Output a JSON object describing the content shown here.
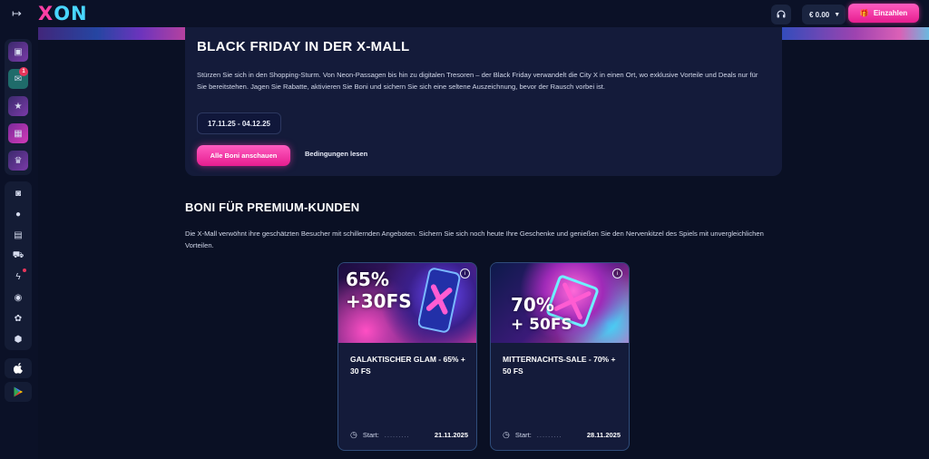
{
  "header": {
    "logo_x": "X",
    "logo_on": "ON",
    "balance": "€ 0.00",
    "deposit_label": "Einzahlen"
  },
  "sidebar": {
    "messages_badge": "1",
    "icons": [
      "games-icon",
      "mail-icon",
      "promo-icon",
      "gift-icon",
      "trophy-icon",
      "casino-icon",
      "sports-icon",
      "bonus-icon",
      "shop-icon",
      "flash-icon",
      "profile-icon",
      "settings-icon",
      "shield-icon",
      "apple-icon",
      "google-play-icon"
    ]
  },
  "promo": {
    "title": "BLACK FRIDAY IN DER X-MALL",
    "text": "Stürzen Sie sich in den Shopping-Sturm. Von Neon-Passagen bis hin zu digitalen Tresoren – der Black Friday verwandelt die City X in einen Ort, wo exklusive Vorteile und Deals nur für Sie bereitstehen. Jagen Sie Rabatte, aktivieren Sie Boni und sichern Sie sich eine seltene Auszeichnung, bevor der Rausch vorbei ist.",
    "date_range": "17.11.25 - 04.12.25",
    "cta_label": "Alle Boni anschauen",
    "terms_label": "Bedingungen lesen"
  },
  "premium": {
    "title": "BONI FÜR PREMIUM-KUNDEN",
    "text": "Die X-Mall verwöhnt ihre geschätzten Besucher mit schillernden Angeboten. Sichern Sie sich noch heute Ihre Geschenke und genießen Sie den Nervenkitzel des Spiels mit unvergleichlichen Vorteilen."
  },
  "cards": [
    {
      "img_line1": "65%",
      "img_line2": "+30FS",
      "title": "GALAKTISCHER GLAM - 65% + 30 FS",
      "start_label": "Start:",
      "dots": ".........",
      "date": "21.11.2025",
      "info": "i"
    },
    {
      "img_line1": "70%",
      "img_line2": "+ 50FS",
      "title": "MITTERNACHTS-SALE - 70% + 50 FS",
      "start_label": "Start:",
      "dots": ".........",
      "date": "28.11.2025",
      "info": "i"
    }
  ]
}
